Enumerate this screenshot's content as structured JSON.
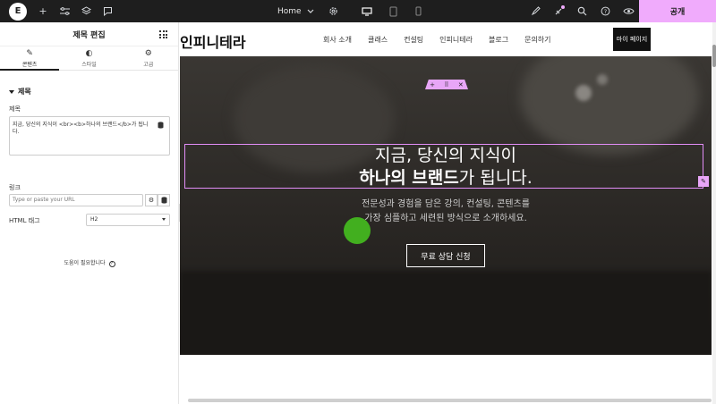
{
  "topbar": {
    "page_name": "Home",
    "publish_label": "공개"
  },
  "panel": {
    "title": "제목 편집",
    "tabs": [
      {
        "label": "콘텐츠",
        "icon": "pencil-icon"
      },
      {
        "label": "스타일",
        "icon": "half-circle-icon"
      },
      {
        "label": "고급",
        "icon": "gear-icon"
      }
    ],
    "section_title": "제목",
    "title_label": "제목",
    "title_value": "지금, 당신의 지식이 <br><b>하나의 브랜드</b>가 됩니다.",
    "link_label": "링크",
    "link_placeholder": "Type or paste your URL",
    "html_tag_label": "HTML 태그",
    "html_tag_value": "H2",
    "help_label": "도움이 필요합니다"
  },
  "site": {
    "brand": "인피니테라",
    "nav": [
      "회사 소개",
      "클래스",
      "컨설팅",
      "인피니테라",
      "블로그",
      "문의하기"
    ],
    "mypage_label": "마이 페이지",
    "hero_line1": "지금, 당신의 지식이",
    "hero_line2_bold": "하나의 브랜드",
    "hero_line2_rest": "가 됩니다.",
    "hero_sub_line1": "전문성과 경험을 담은 강의, 컨설팅, 콘텐츠를",
    "hero_sub_line2": "가장 심플하고 세련된 방식으로 소개하세요.",
    "cta_label": "무료 상담 신청"
  },
  "colors": {
    "accent": "#f0abfc",
    "topbar": "#1e1e1e",
    "selection": "#e28df7"
  }
}
